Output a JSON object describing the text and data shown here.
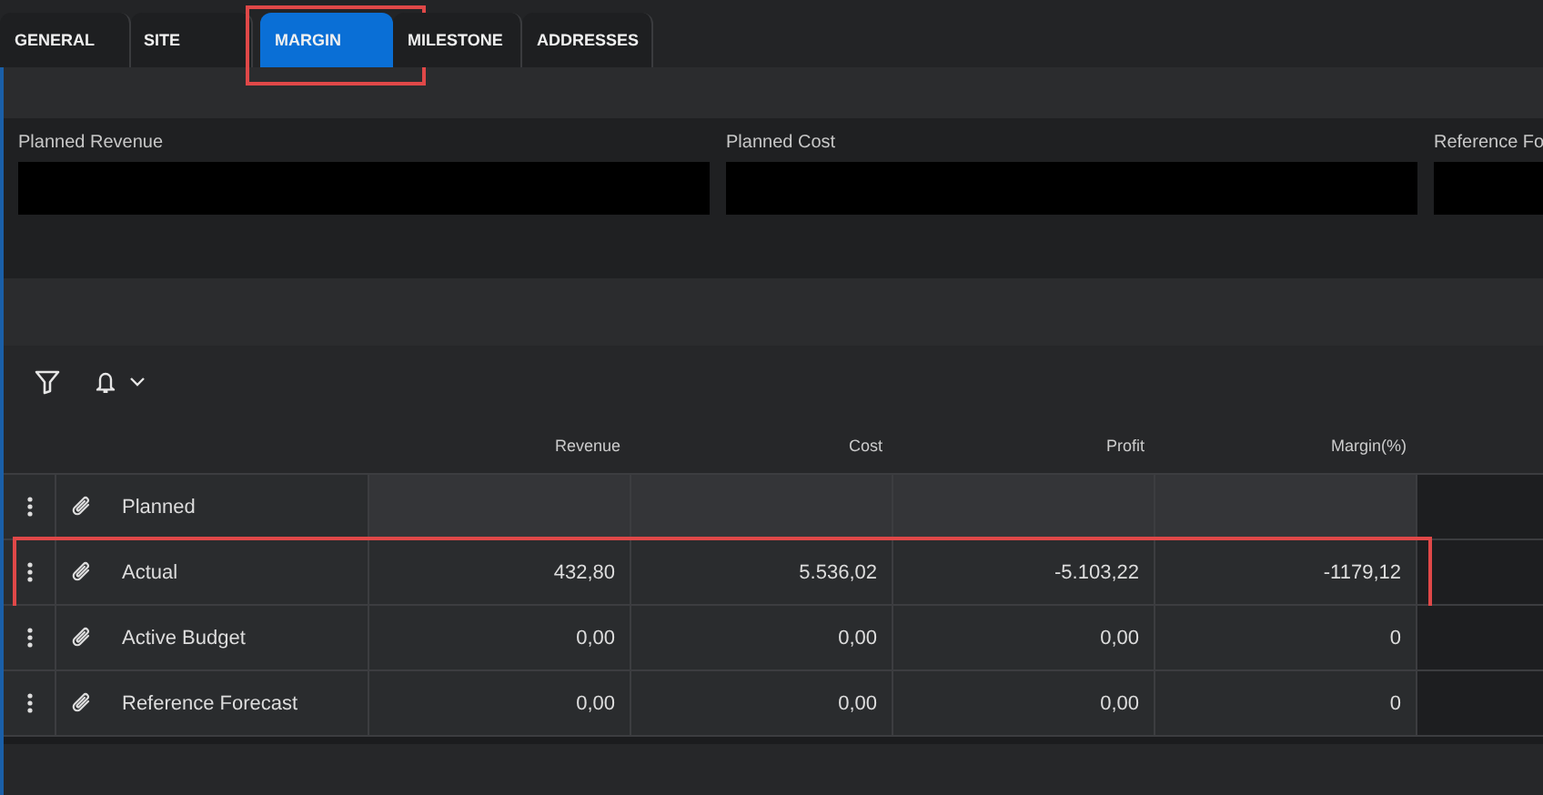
{
  "tabs": [
    {
      "label": "GENERAL",
      "selected": false,
      "highlighted": false
    },
    {
      "label": "SITE",
      "selected": false,
      "highlighted": false
    },
    {
      "label": "MARGIN",
      "selected": true,
      "highlighted": true
    },
    {
      "label": "MILESTONE",
      "selected": false,
      "highlighted": false
    },
    {
      "label": "ADDRESSES",
      "selected": false,
      "highlighted": false
    }
  ],
  "fields": [
    {
      "label": "Planned Revenue"
    },
    {
      "label": "Planned Cost"
    },
    {
      "label": "Reference Fo"
    }
  ],
  "table": {
    "columns": [
      "Revenue",
      "Cost",
      "Profit",
      "Margin(%)"
    ],
    "rows": [
      {
        "name": "Planned",
        "highlighted": false
      },
      {
        "name": "Actual",
        "highlighted": true,
        "values": [
          "432,80",
          "5.536,02",
          "-5.103,22",
          "-1179,12"
        ]
      },
      {
        "name": "Active Budget",
        "highlighted": false,
        "values": [
          "0,00",
          "0,00",
          "0,00",
          "0"
        ]
      },
      {
        "name": "Reference Forecast",
        "highlighted": false,
        "values": [
          "0,00",
          "0,00",
          "0,00",
          "0"
        ]
      }
    ]
  }
}
